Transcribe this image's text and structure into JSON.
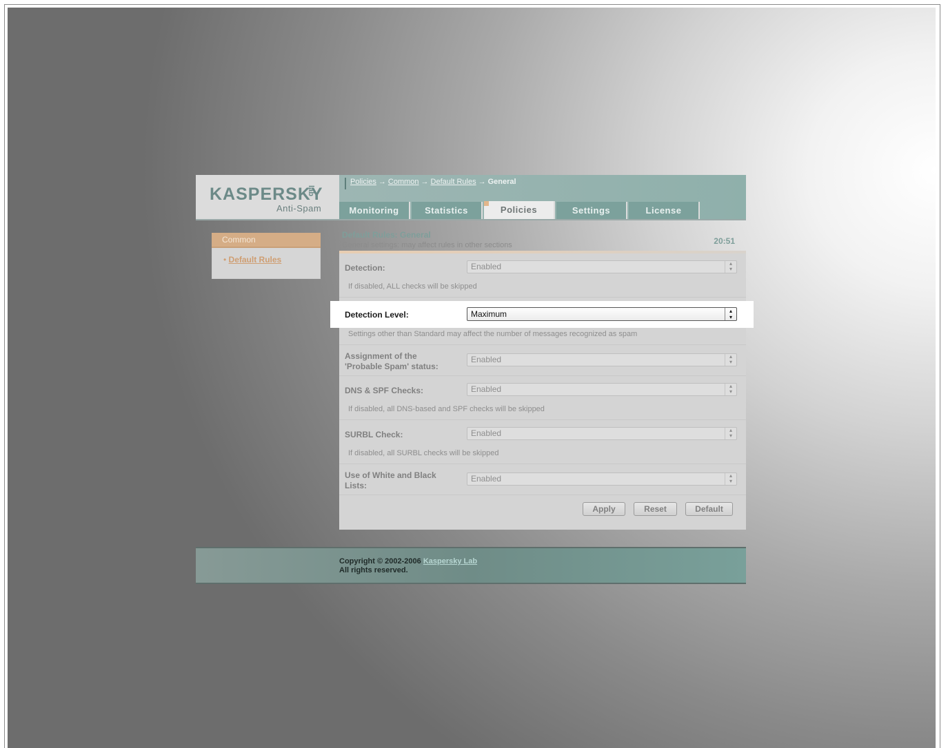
{
  "header": {
    "logo_text": "KASPERSKY",
    "logo_lab": "lab",
    "product": "Anti-Spam",
    "breadcrumb": [
      "Policies",
      "Common",
      "Default Rules"
    ],
    "breadcrumb_arrow": "→",
    "breadcrumb_current": "General",
    "tabs": [
      {
        "label": "Monitoring",
        "active": false
      },
      {
        "label": "Statistics",
        "active": false
      },
      {
        "label": "Policies",
        "active": true
      },
      {
        "label": "Settings",
        "active": false
      },
      {
        "label": "License",
        "active": false
      }
    ]
  },
  "sidebar": {
    "heading": "Common",
    "items": [
      {
        "label": "Default Rules"
      }
    ]
  },
  "main": {
    "title": "Default Rules: General",
    "subtitle": "General settings: may affect rules in other sections",
    "clock": "20:51",
    "rows": [
      {
        "label": "Detection:",
        "value": "Enabled",
        "hint": "If disabled, ALL checks will be skipped"
      },
      {
        "label": "Detection Level:",
        "value": "Maximum",
        "hint": "Settings other than Standard may affect the number of messages recognized as spam"
      },
      {
        "label": "Assignment of the 'Probable Spam' status:",
        "label_line1": "Assignment of the",
        "label_line2": "'Probable Spam' status:",
        "value": "Enabled"
      },
      {
        "label": "DNS & SPF Checks:",
        "value": "Enabled",
        "hint": "If disabled, all DNS-based and SPF checks will be skipped"
      },
      {
        "label": "SURBL Check:",
        "value": "Enabled",
        "hint": "If disabled, all SURBL checks will be skipped"
      },
      {
        "label": "Use of White and Black Lists:",
        "label_line1": "Use of White and Black",
        "label_line2": "Lists:",
        "value": "Enabled"
      }
    ],
    "buttons": {
      "apply": "Apply",
      "reset": "Reset",
      "default": "Default"
    }
  },
  "footer": {
    "copyright": "Copyright © 2002-2006",
    "company": "Kaspersky Lab",
    "rights": "All rights reserved."
  },
  "colors": {
    "header_teal": "#8fb0ab",
    "accent_orange": "#d5ad86",
    "highlight_bg": "#ffffff"
  }
}
